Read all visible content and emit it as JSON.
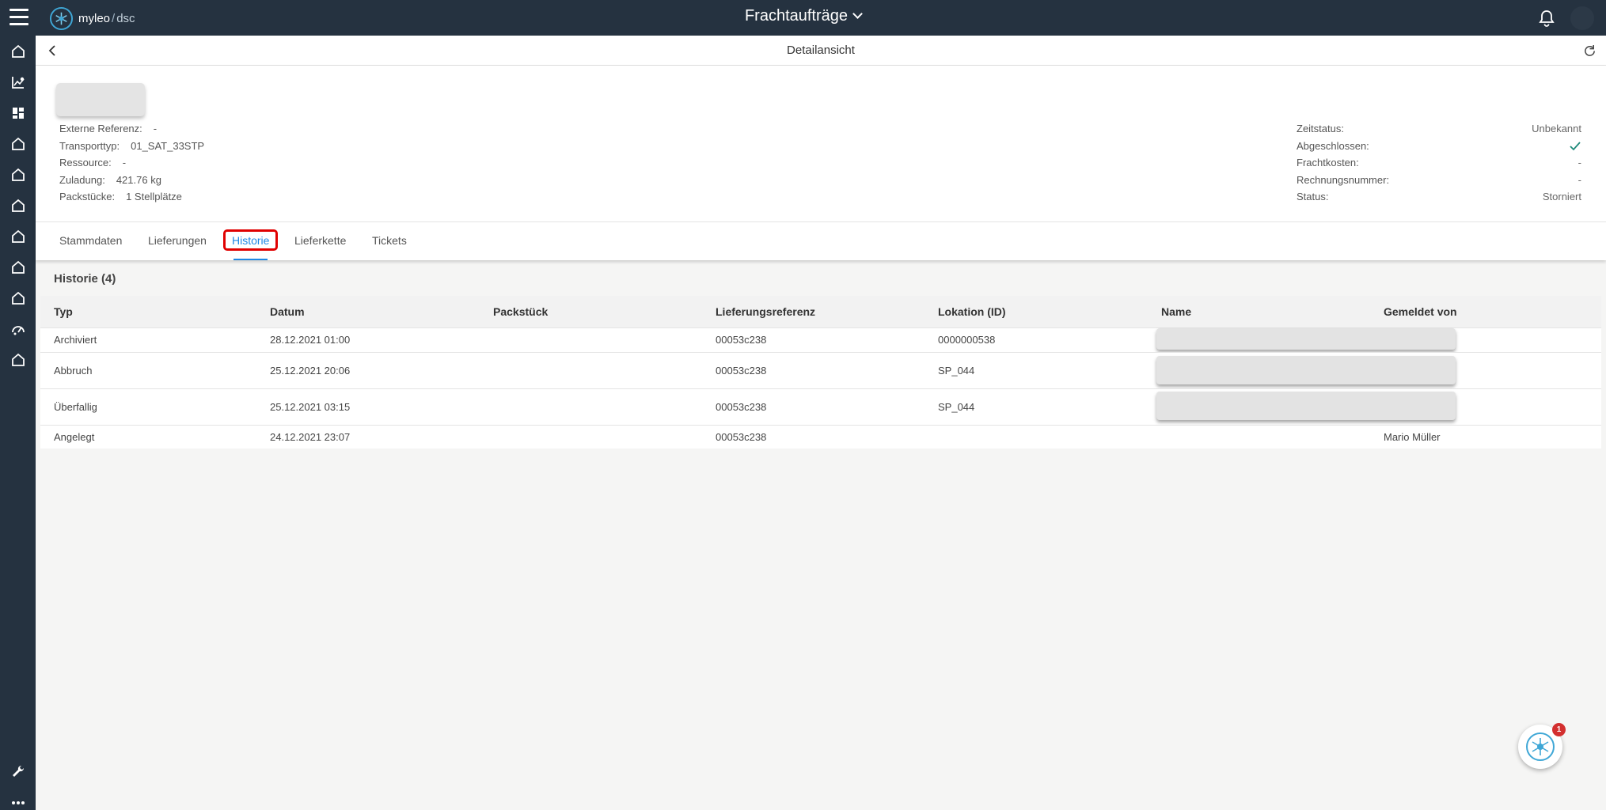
{
  "topbar": {
    "logo_brand": "myleo",
    "logo_sep": "/",
    "logo_sub": "dsc",
    "title": "Frachtaufträge"
  },
  "subheader": {
    "title": "Detailansicht"
  },
  "details_left": [
    {
      "label": "Externe Referenz:",
      "value": "-"
    },
    {
      "label": "Transporttyp:",
      "value": "01_SAT_33STP"
    },
    {
      "label": "Ressource:",
      "value": "-"
    },
    {
      "label": "Zuladung:",
      "value": "421.76 kg"
    },
    {
      "label": "Packstücke:",
      "value": "1 Stellplätze"
    }
  ],
  "details_right": [
    {
      "label": "Zeitstatus:",
      "value": "Unbekannt"
    },
    {
      "label": "Abgeschlossen:",
      "value": ""
    },
    {
      "label": "Frachtkosten:",
      "value": "-"
    },
    {
      "label": "Rechnungsnummer:",
      "value": "-"
    },
    {
      "label": "Status:",
      "value": "Storniert"
    }
  ],
  "tabs": [
    {
      "label": "Stammdaten"
    },
    {
      "label": "Lieferungen"
    },
    {
      "label": "Historie"
    },
    {
      "label": "Lieferkette"
    },
    {
      "label": "Tickets"
    }
  ],
  "history": {
    "title": "Historie (4)",
    "columns": [
      "Typ",
      "Datum",
      "Packstück",
      "Lieferungsreferenz",
      "Lokation (ID)",
      "Name",
      "Gemeldet von"
    ],
    "rows": [
      {
        "typ": "Archiviert",
        "datum": "28.12.2021 01:00",
        "packstueck": "",
        "referenz": "00053c238",
        "lokation": "0000000538",
        "name": "",
        "gemeldet": ""
      },
      {
        "typ": "Abbruch",
        "datum": "25.12.2021 20:06",
        "packstueck": "",
        "referenz": "00053c238",
        "lokation": "SP_044",
        "name": "",
        "gemeldet": ""
      },
      {
        "typ": "Überfallig",
        "datum": "25.12.2021 03:15",
        "packstueck": "",
        "referenz": "00053c238",
        "lokation": "SP_044",
        "name": "",
        "gemeldet": ""
      },
      {
        "typ": "Angelegt",
        "datum": "24.12.2021 23:07",
        "packstueck": "",
        "referenz": "00053c238",
        "lokation": "",
        "name": "",
        "gemeldet": "Mario Müller"
      }
    ]
  },
  "assistant": {
    "badge": "1"
  },
  "colors": {
    "nav_bg": "#253240",
    "accent": "#1e88e5",
    "highlight": "#e00000",
    "check": "#1e8a7a"
  },
  "sidebar_icons": [
    "home-icon",
    "chart-icon",
    "dashboard-icon",
    "home-icon",
    "home-icon",
    "home-icon",
    "home-icon",
    "home-icon",
    "home-icon",
    "speedometer-icon",
    "home-icon",
    "wrench-icon",
    "more-icon"
  ]
}
